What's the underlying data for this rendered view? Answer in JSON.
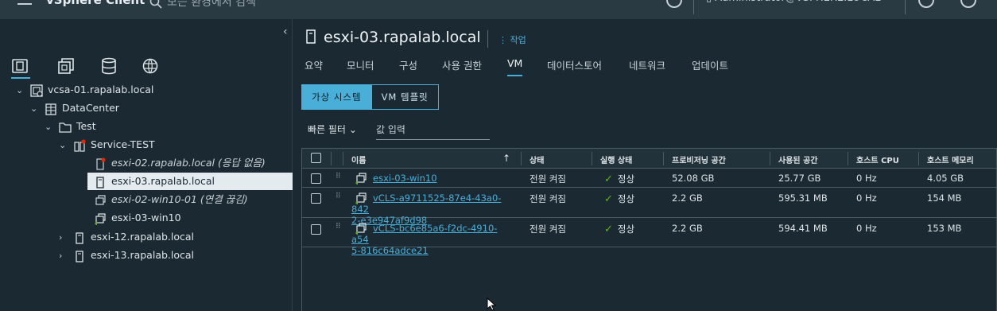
{
  "topbar": {
    "app_title": "vSphere Client",
    "search_placeholder": "모든 환경에서 검색"
  },
  "left_panel": {
    "tree": [
      {
        "label": "vcsa-01.rapalab.local"
      },
      {
        "label": "DataCenter"
      },
      {
        "label": "Test"
      },
      {
        "label": "Service-TEST"
      },
      {
        "label": "esxi-02.rapalab.local (응답 없음)"
      },
      {
        "label": "esxi-03.rapalab.local"
      },
      {
        "label": "esxi-02-win10-01 (연결 끊김)"
      },
      {
        "label": "esxi-03-win10"
      },
      {
        "label": "esxi-12.rapalab.local"
      },
      {
        "label": "esxi-13.rapalab.local"
      }
    ]
  },
  "main": {
    "host_title": "esxi-03.rapalab.local",
    "actions_label": "작업",
    "tabs": [
      "요약",
      "모니터",
      "구성",
      "사용 권한",
      "VM",
      "데이터스토어",
      "네트워크",
      "업데이트"
    ],
    "active_tab": "VM",
    "segments": {
      "vms": "가상 시스템",
      "templates": "VM 템플릿"
    },
    "quick_filter": "빠른 필터",
    "filter_placeholder": "값 입력",
    "columns": [
      "이름",
      "상태",
      "실행 상태",
      "프로비저닝 공간",
      "사용된 공간",
      "호스트 CPU",
      "호스트 메모리"
    ],
    "rows": [
      {
        "name_line1": "esxi-03-win10",
        "name_line2": "",
        "state": "전원 켜짐",
        "run_state": "정상",
        "provisioned": "52.08 GB",
        "used": "25.77 GB",
        "cpu": "0 Hz",
        "mem": "4.05 GB"
      },
      {
        "name_line1": "vCLS-a9711525-87e4-43a0-842",
        "name_line2": "2-e3e947af9d98",
        "state": "전원 켜짐",
        "run_state": "정상",
        "provisioned": "2.2 GB",
        "used": "595.31 MB",
        "cpu": "0 Hz",
        "mem": "154 MB"
      },
      {
        "name_line1": "vCLS-bc6e85a6-f2dc-4910-a54",
        "name_line2": "5-816c64adce21",
        "state": "전원 켜짐",
        "run_state": "정상",
        "provisioned": "2.2 GB",
        "used": "594.41 MB",
        "cpu": "0 Hz",
        "mem": "153 MB"
      }
    ]
  },
  "colors": {
    "accent": "#49afd9",
    "ok": "#60b515",
    "bg": "#1b2a32"
  }
}
